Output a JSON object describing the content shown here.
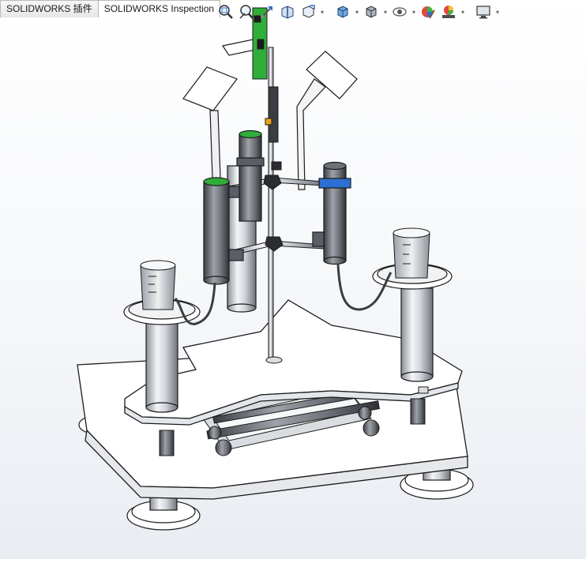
{
  "tabs": [
    {
      "label": "SOLIDWORKS 插件",
      "active": false
    },
    {
      "label": "SOLIDWORKS Inspection",
      "active": true
    }
  ],
  "heads_up_toolbar": {
    "buttons": [
      {
        "icon": "zoom-to-fit-icon"
      },
      {
        "icon": "zoom-to-area-icon"
      },
      {
        "icon": "previous-view-icon"
      },
      {
        "icon": "section-view-icon"
      },
      {
        "icon": "dynamic-annotation-views-icon"
      },
      {
        "icon": "view-orientation-icon",
        "dropdown": true
      },
      {
        "icon": "display-style-icon",
        "dropdown": true
      },
      {
        "icon": "hide-show-items-icon",
        "dropdown": true
      },
      {
        "icon": "edit-appearance-icon"
      },
      {
        "icon": "apply-scene-icon",
        "dropdown": true
      },
      {
        "icon": "view-settings-icon",
        "dropdown": true
      }
    ]
  },
  "colors": {
    "bg_top": "#ffffff",
    "bg_bottom": "#e9edf2",
    "model_fill": "#ffffff",
    "model_edge": "#1c1c1c",
    "metal_dark": "#5a5e66",
    "accent_green": "#2fae3a",
    "accent_blue": "#2d6fd2"
  }
}
